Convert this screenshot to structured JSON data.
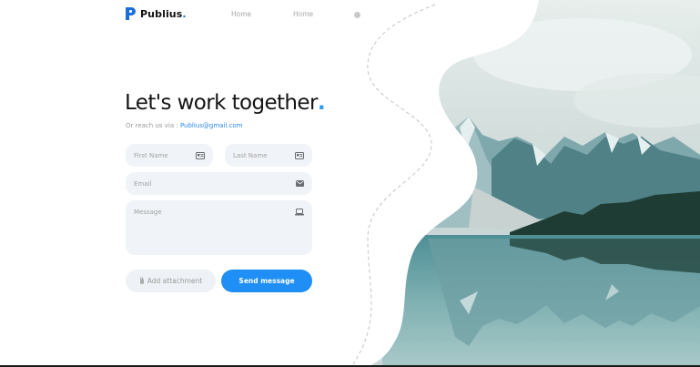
{
  "brand": {
    "name": "Publius",
    "dot": ".",
    "accent": "#1c6fd8"
  },
  "nav": {
    "links": [
      "Home",
      "Home"
    ]
  },
  "hero": {
    "title": "Let's work together",
    "title_dot": ".",
    "subtitle_prefix": "Or reach us via : ",
    "email": "Publius@gmail.com"
  },
  "form": {
    "first_name_placeholder": "First Name",
    "last_name_placeholder": "Last Name",
    "email_placeholder": "Email",
    "message_placeholder": "Message",
    "attach_label": "Add attachment",
    "send_label": "Send message"
  },
  "colors": {
    "accent": "#2b9af3",
    "button": "#1f8ff5",
    "field_bg": "#f0f3f7"
  },
  "icons": [
    "id-card-icon",
    "id-card-icon",
    "mail-icon",
    "laptop-icon",
    "paperclip-icon"
  ]
}
